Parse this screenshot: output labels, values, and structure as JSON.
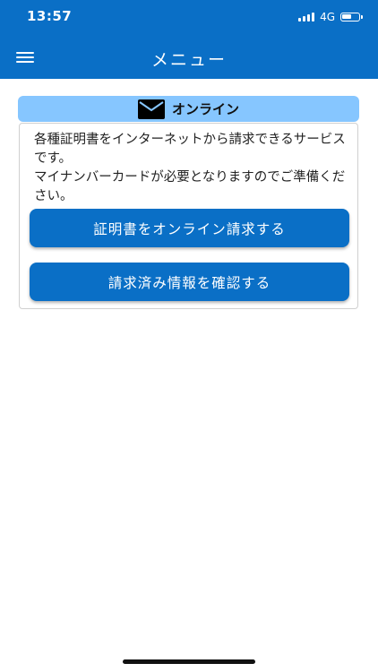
{
  "status_bar": {
    "time": "13:57",
    "network": "4G",
    "battery_level": 0.6
  },
  "app_bar": {
    "title": "メニュー",
    "menu_icon": "hamburger-menu-icon"
  },
  "online_section": {
    "header_icon": "mail-icon",
    "header_label": "オンライン",
    "description": "各種証明書をインターネットから請求できるサービスです。\nマイナンバーカードが必要となりますのでご準備ください。",
    "buttons": [
      {
        "label": "証明書をオンライン請求する"
      },
      {
        "label": "請求済み情報を確認する"
      }
    ]
  },
  "colors": {
    "primary": "#0a6fc6",
    "header_bg": "#86c6ff"
  }
}
